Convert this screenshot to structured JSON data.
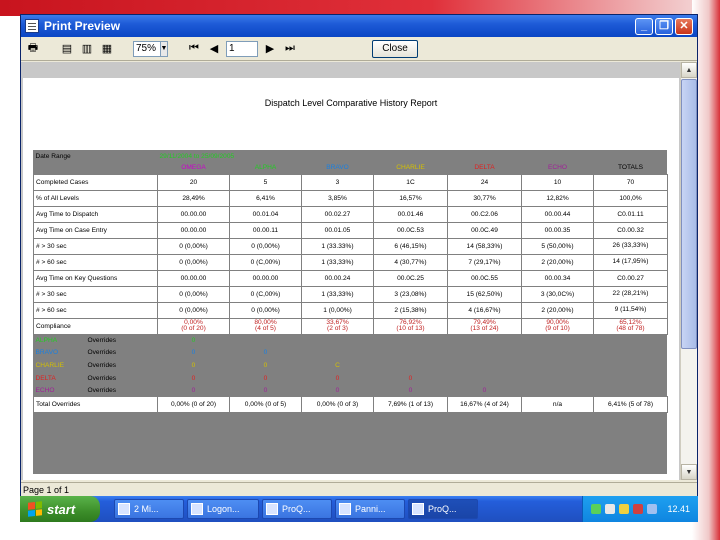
{
  "window": {
    "title": "Print Preview"
  },
  "toolbar": {
    "zoom": "75%",
    "page_number": "1",
    "close_label": "Close"
  },
  "report": {
    "title": "Dispatch Level Comparative History Report",
    "date_range_label": "Date Range",
    "date_range_value": "29/11/2004 to 25/09/2005",
    "columns": [
      "OMEGA",
      "ALPHA",
      "BRAVO",
      "CHARLIE",
      "DELTA",
      "ECHO",
      "TOTALS"
    ],
    "column_colors": [
      "#cc00cc",
      "#22cc22",
      "#1a7fe0",
      "#d4c000",
      "#e02020",
      "#a02098",
      "#000000"
    ],
    "rows": [
      {
        "label": "Completed Cases",
        "values": [
          "20",
          "5",
          "3",
          "1C",
          "24",
          "10",
          "70"
        ]
      },
      {
        "label": "% of All Levels",
        "values": [
          "28,49%",
          "6,41%",
          "3,85%",
          "16,57%",
          "30,77%",
          "12,82%",
          "100,0%"
        ]
      },
      {
        "label": "Avg Time to Dispatch",
        "values": [
          "00.00.00",
          "00.01.04",
          "00.02.27",
          "00.01.46",
          "00.C2.06",
          "00.00.44",
          "C0.01.11"
        ]
      },
      {
        "label": "Avg Time on Case Entry",
        "values": [
          "00.00.00",
          "00.00.11",
          "00.01.05",
          "00.0C.53",
          "00.0C.49",
          "00.00.35",
          "C0.00.32"
        ]
      },
      {
        "label": "# > 30 sec",
        "values": [
          "0 (0,00%)",
          "0 (0,00%)",
          "1 (33.33%)",
          "6 (46,15%)",
          "14 (58,33%)",
          "5 (50,00%)",
          "26 (33,33%)"
        ]
      },
      {
        "label": "# > 60 sec",
        "values": [
          "0 (0,00%)",
          "0 (C,00%)",
          "1 (33,33%)",
          "4 (30,77%)",
          "7 (29,17%)",
          "2 (20,00%)",
          "14 (17,95%)"
        ]
      },
      {
        "label": "Avg Time on Key Questions",
        "values": [
          "00.00.00",
          "00.00.00",
          "00.00.24",
          "00.0C.25",
          "00.0C.55",
          "00.00.34",
          "C0.00.27"
        ]
      },
      {
        "label": "# > 30 sec",
        "values": [
          "0 (0,00%)",
          "0 (C,00%)",
          "1 (33,33%)",
          "3 (23,08%)",
          "15 (62,50%)",
          "3 (30,0C%)",
          "22 (28,21%)"
        ]
      },
      {
        "label": "# > 60 sec",
        "values": [
          "0 (0,00%)",
          "0 (0,00%)",
          "1 (0,00%)",
          "2 (15,38%)",
          "4 (16,67%)",
          "2 (20,00%)",
          "9 (11,54%)"
        ]
      },
      {
        "label": "Compliance",
        "values": [
          "0,00%\n(0 of 20)",
          "80,00%\n(4 of 5)",
          "33,67%\n(2 of 3)",
          "76,92%\n(10 of 13)",
          "79,49%\n(13 of 24)",
          "90,00%\n(9 of 10)",
          "65,12%\n(48 of 78)"
        ]
      }
    ],
    "overrides_label": "Overrides",
    "overrides": [
      {
        "name": "ALPHA",
        "values": [
          "0",
          "",
          "",
          "",
          "",
          ""
        ]
      },
      {
        "name": "BRAVO",
        "values": [
          "0",
          "0",
          "",
          "",
          "",
          ""
        ]
      },
      {
        "name": "CHARLIE",
        "values": [
          "0",
          "0",
          "C",
          "",
          "",
          ""
        ]
      },
      {
        "name": "DELTA",
        "values": [
          "0",
          "0",
          "0",
          "0",
          "",
          ""
        ]
      },
      {
        "name": "ECHO",
        "values": [
          "0",
          "0",
          "0",
          "0",
          "0",
          ""
        ]
      }
    ],
    "total_overrides": {
      "label": "Total Overrides",
      "values": [
        "0,00% (0 of 20)",
        "0,00% (0 of 5)",
        "0,00% (0 of 3)",
        "7,69% (1 of 13)",
        "16,67% (4 of 24)",
        "n/a",
        "6,41% (5 of 78)"
      ]
    }
  },
  "status": {
    "page": "Page 1 of 1"
  },
  "taskbar": {
    "start_label": "start",
    "tasks": [
      "2 Mi...",
      "Logon...",
      "ProQ...",
      "Panni...",
      "ProQ..."
    ],
    "clock": "12.41"
  }
}
